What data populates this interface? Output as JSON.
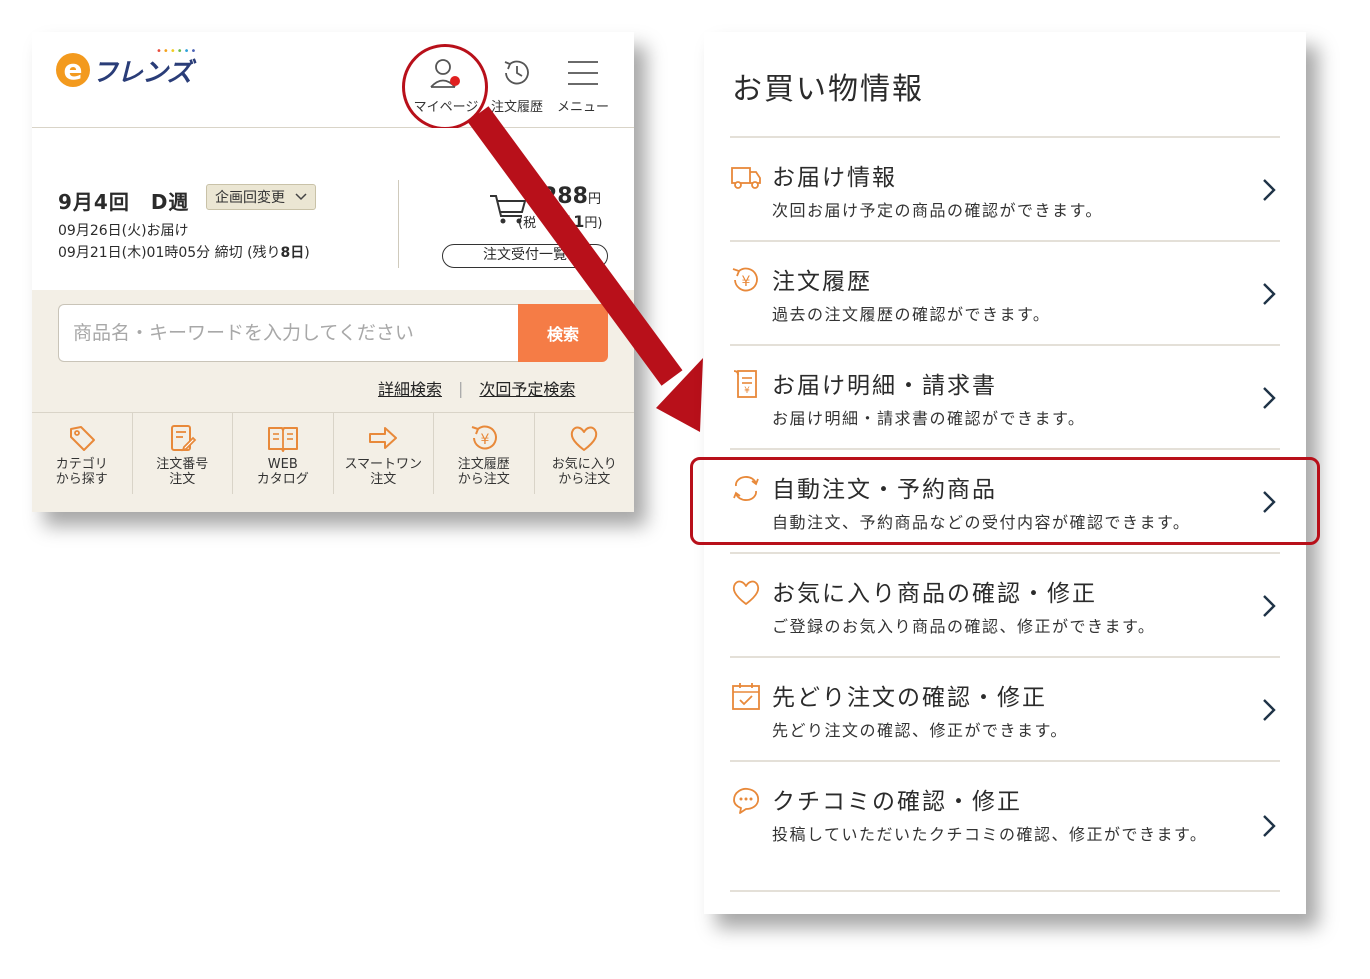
{
  "left_panel": {
    "logo_text": "フレンズ",
    "header_icons": {
      "mypage": "マイページ",
      "history": "注文履歴",
      "menu": "メニュー"
    },
    "week": {
      "title": "9月4回　D週",
      "plan_change": "企画回変更",
      "delivery": "09月26日(火)お届け",
      "deadline_prefix": "09月21日(木)01時05分 締切 (残り",
      "deadline_days": "8日",
      "deadline_suffix": ")",
      "cart_amount": "288",
      "cart_yen": "円",
      "cart_tax_prefix": "(税",
      "cart_tax_value": "11",
      "cart_tax_suffix": "円)",
      "order_accept": "注文受付一覧"
    },
    "search": {
      "placeholder": "商品名・キーワードを入力してください",
      "button": "検索",
      "detail_link": "詳細検索",
      "next_link": "次回予定検索"
    },
    "quick_nav": [
      {
        "line1": "カテゴリ",
        "line2": "から探す",
        "icon": "tag-icon"
      },
      {
        "line1": "注文番号",
        "line2": "注文",
        "icon": "order-number-icon"
      },
      {
        "line1": "WEB",
        "line2": "カタログ",
        "icon": "catalog-icon"
      },
      {
        "line1": "スマートワン",
        "line2": "注文",
        "icon": "arrow-right-icon"
      },
      {
        "line1": "注文履歴",
        "line2": "から注文",
        "icon": "yen-history-icon"
      },
      {
        "line1": "お気に入り",
        "line2": "から注文",
        "icon": "heart-icon"
      }
    ]
  },
  "right_panel": {
    "title": "お買い物情報",
    "items": [
      {
        "title": "お届け情報",
        "desc": "次回お届け予定の商品の確認ができます。",
        "icon": "truck-icon"
      },
      {
        "title": "注文履歴",
        "desc": "過去の注文履歴の確認ができます。",
        "icon": "yen-history-icon"
      },
      {
        "title": "お届け明細・請求書",
        "desc": "お届け明細・請求書の確認ができます。",
        "icon": "receipt-icon"
      },
      {
        "title": "自動注文・予約商品",
        "desc": "自動注文、予約商品などの受付内容が確認できます。",
        "icon": "repeat-icon"
      },
      {
        "title": "お気に入り商品の確認・修正",
        "desc": "ご登録のお気入り商品の確認、修正ができます。",
        "icon": "heart-icon"
      },
      {
        "title": "先どり注文の確認・修正",
        "desc": "先どり注文の確認、修正ができます。",
        "icon": "calendar-icon"
      },
      {
        "title": "クチコミの確認・修正",
        "desc": "投稿していただいたクチコミの確認、修正ができます。",
        "icon": "review-icon"
      }
    ]
  },
  "colors": {
    "accent_orange": "#f57c46",
    "icon_orange": "#e8893a",
    "highlight_red": "#b8101a",
    "panel_beige": "#f3efe6"
  }
}
